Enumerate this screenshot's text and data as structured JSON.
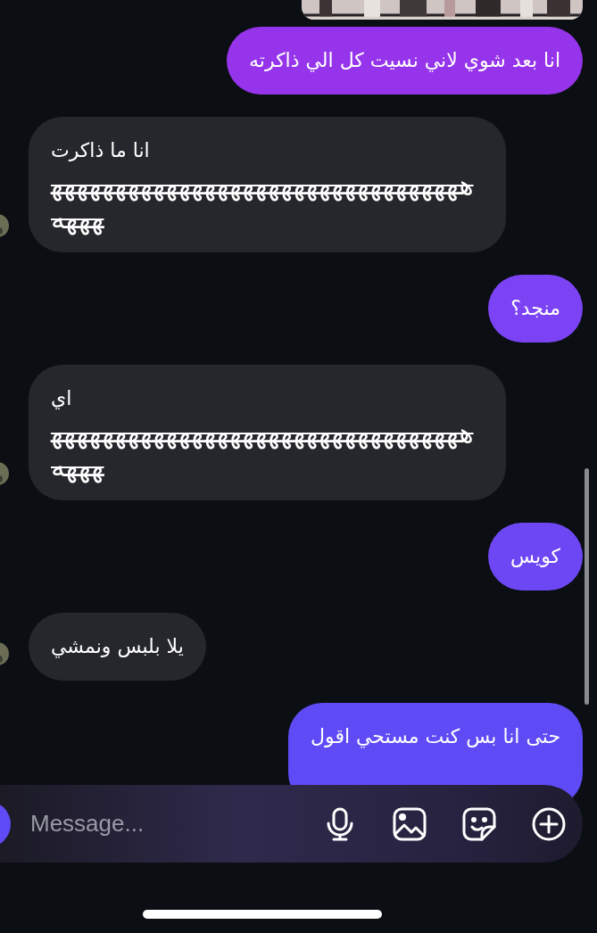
{
  "messages": [
    {
      "kind": "sent_picture"
    },
    {
      "kind": "sent",
      "color": "#9534ea",
      "lines": [
        {
          "text": "انا بعد شوي لاني نسيت كل الي ذاكرته",
          "struck": false
        }
      ]
    },
    {
      "kind": "received",
      "avatar": true,
      "lines": [
        {
          "text": "انا ما ذاكرت",
          "struck": false
        },
        {
          "text": "ههههههههههههههههههههههههههههههههههههه",
          "struck": true
        }
      ]
    },
    {
      "kind": "sent",
      "color": "#7c43f5",
      "lines": [
        {
          "text": "منجد؟",
          "struck": false
        }
      ]
    },
    {
      "kind": "received",
      "avatar": true,
      "lines": [
        {
          "text": "اي",
          "struck": false
        },
        {
          "text": "ههههههههههههههههههههههههههههههههههههه",
          "struck": true
        }
      ]
    },
    {
      "kind": "sent",
      "color": "#6e47f5",
      "lines": [
        {
          "text": "كويس",
          "struck": false
        }
      ]
    },
    {
      "kind": "received",
      "avatar": true,
      "lines": [
        {
          "text": "يلا بلبس ونمشي",
          "struck": false
        }
      ]
    },
    {
      "kind": "sent",
      "color": "#5e4bf5",
      "lines": [
        {
          "text": "حتى انا بس كنت مستحي اقول",
          "struck": false
        }
      ]
    }
  ],
  "composer": {
    "placeholder": "Message..."
  }
}
